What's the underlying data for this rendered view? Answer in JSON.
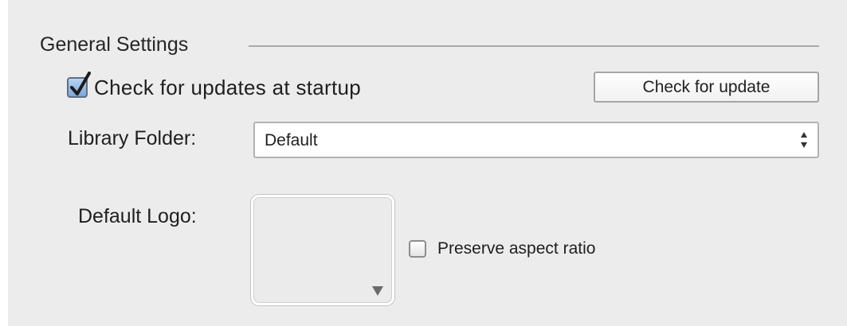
{
  "general": {
    "section_title": "General Settings",
    "check_updates": {
      "label": "Check for updates at startup",
      "checked": true
    },
    "check_update_button": "Check for update",
    "library_folder": {
      "label": "Library Folder:",
      "selected": "Default"
    },
    "default_logo": {
      "label": "Default Logo:"
    },
    "preserve_aspect": {
      "label": "Preserve aspect ratio",
      "checked": false
    }
  },
  "icons": {
    "checkmark": "checkmark-icon",
    "select_arrows": "up-down-arrows-icon",
    "well_menu": "triangle-down-icon"
  },
  "colors": {
    "panel_background": "#ececec",
    "checkbox_checked": "#7ea6da",
    "separator": "#a9a9a9"
  }
}
